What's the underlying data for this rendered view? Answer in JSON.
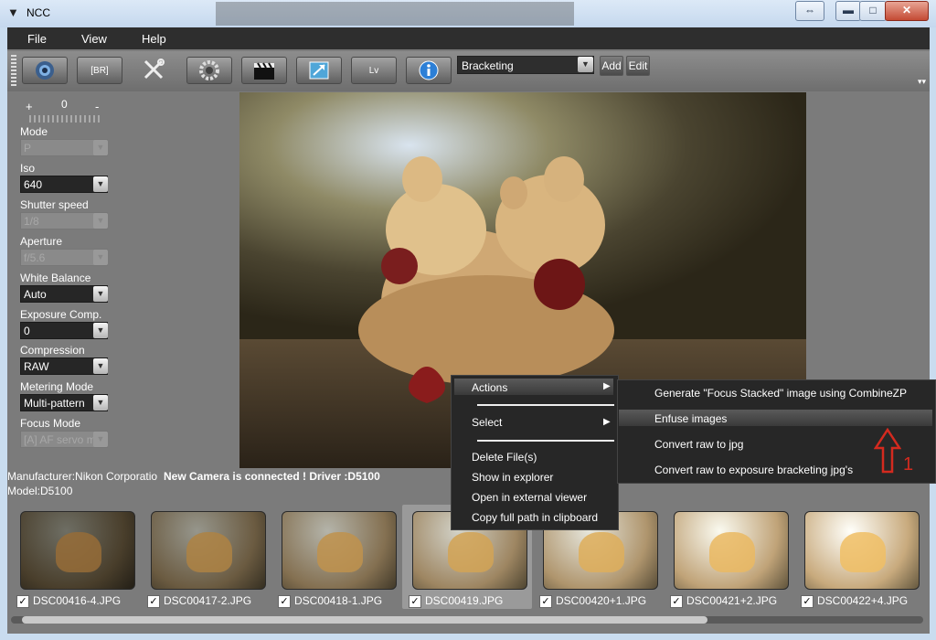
{
  "window": {
    "title": "NCC"
  },
  "menubar": {
    "items": [
      "File",
      "View",
      "Help"
    ]
  },
  "toolbar": {
    "br_label": "[BR]",
    "lv_label": "Lv",
    "bracket_value": "Bracketing",
    "add_label": "Add",
    "edit_label": "Edit"
  },
  "exposure_scale": {
    "plus": "+",
    "zero": "0",
    "minus": "-"
  },
  "settings": [
    {
      "label": "Mode",
      "value": "P",
      "enabled": false
    },
    {
      "label": "Iso",
      "value": "640",
      "enabled": true
    },
    {
      "label": "Shutter speed",
      "value": "1/8",
      "enabled": false
    },
    {
      "label": "Aperture",
      "value": "f/5.6",
      "enabled": false
    },
    {
      "label": "White Balance",
      "value": "Auto",
      "enabled": true
    },
    {
      "label": "Exposure Comp.",
      "value": "0",
      "enabled": true
    },
    {
      "label": "Compression",
      "value": "RAW",
      "enabled": true
    },
    {
      "label": "Metering Mode",
      "value": "Multi-pattern",
      "enabled": true
    },
    {
      "label": "Focus Mode",
      "value": "[A] AF servo m",
      "enabled": false
    }
  ],
  "status": {
    "manufacturer": "Manufacturer:Nikon Corporatio",
    "connection": "New Camera is connected ! Driver :D5100",
    "model": "Model:D5100"
  },
  "thumbnails": [
    {
      "name": "DSC00416-4.JPG",
      "checked": true,
      "brightness": 0.25
    },
    {
      "name": "DSC00417-2.JPG",
      "checked": true,
      "brightness": 0.45
    },
    {
      "name": "DSC00418-1.JPG",
      "checked": true,
      "brightness": 0.6
    },
    {
      "name": "DSC00419.JPG",
      "checked": true,
      "brightness": 0.75,
      "selected": true
    },
    {
      "name": "DSC00420+1.JPG",
      "checked": true,
      "brightness": 0.85
    },
    {
      "name": "DSC00421+2.JPG",
      "checked": true,
      "brightness": 0.95
    },
    {
      "name": "DSC00422+4.JPG",
      "checked": true,
      "brightness": 1.0
    }
  ],
  "context_menu": {
    "actions": "Actions",
    "select": "Select",
    "items": [
      "Delete File(s)",
      "Show in explorer",
      "Open in external viewer",
      "Copy full path in clipboard"
    ]
  },
  "actions_submenu": {
    "items": [
      "Generate \"Focus Stacked\" image using CombineZP",
      "Enfuse images",
      "Convert raw to jpg",
      "Convert raw to exposure bracketing jpg's"
    ],
    "highlighted_index": 1
  },
  "annotation": {
    "number": "1",
    "color": "#d42a1f"
  }
}
